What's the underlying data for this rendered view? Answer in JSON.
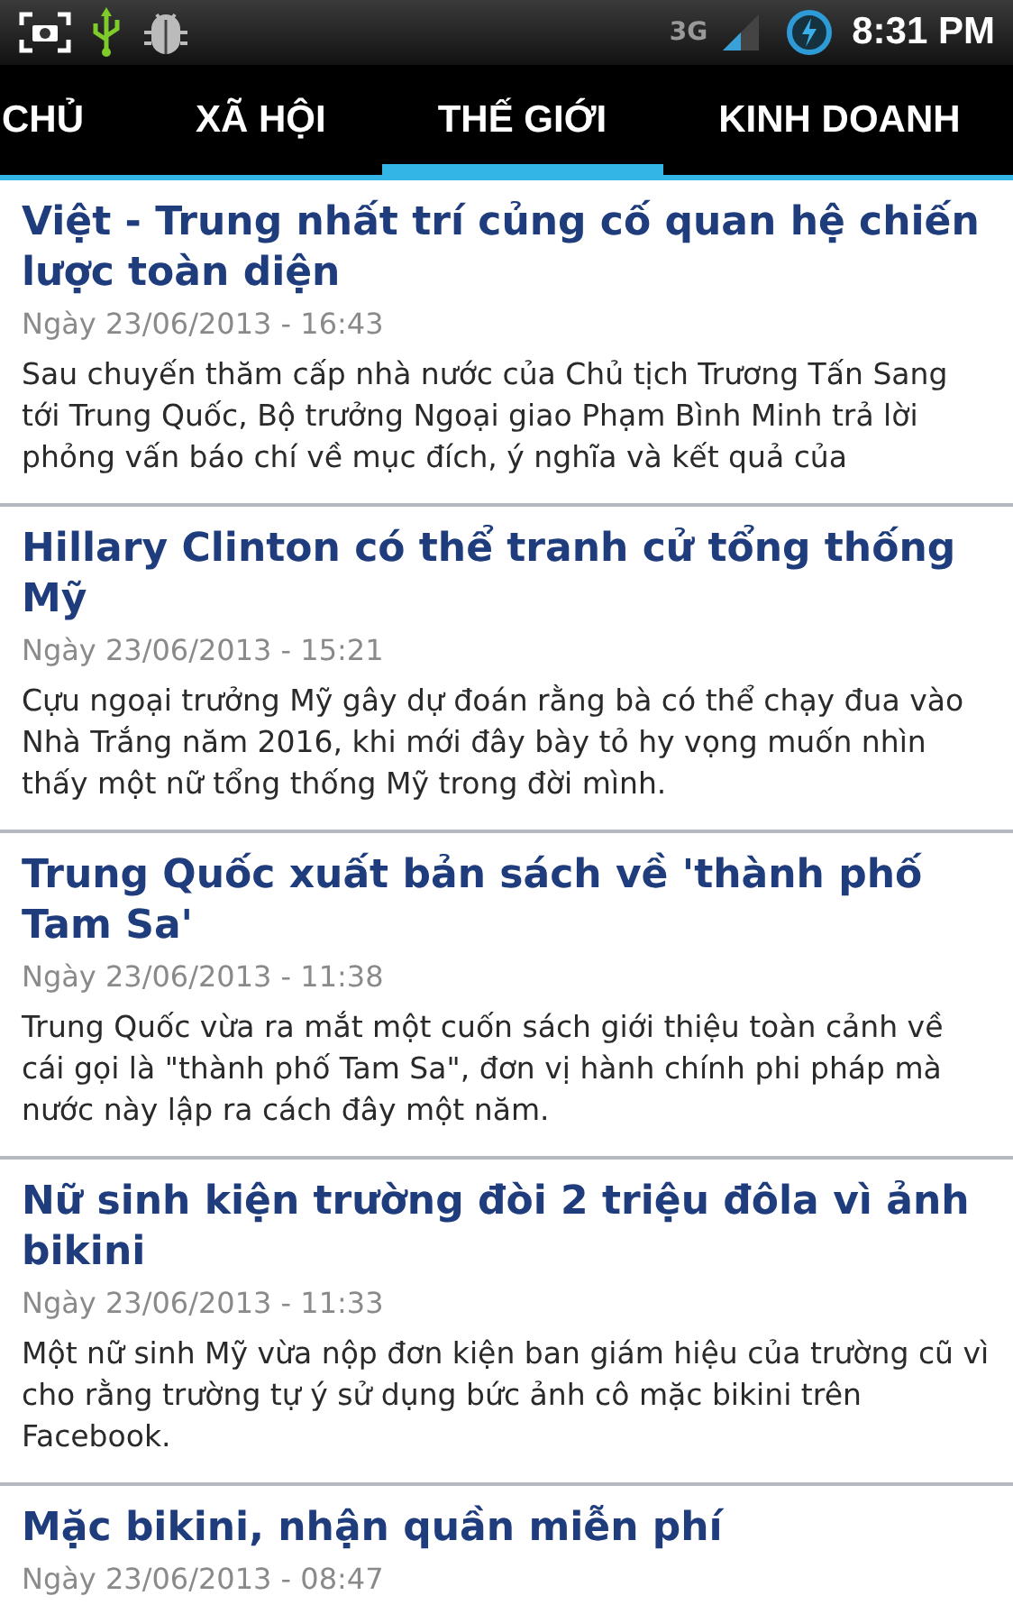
{
  "status_bar": {
    "network": "3G",
    "time": "8:31 PM"
  },
  "tabs": [
    {
      "label": "CHỦ",
      "selected": false
    },
    {
      "label": "XÃ HỘI",
      "selected": false
    },
    {
      "label": "THẾ GIỚI",
      "selected": true
    },
    {
      "label": "KINH DOANH",
      "selected": false
    }
  ],
  "articles": [
    {
      "title": "Việt - Trung nhất trí củng cố quan hệ chiến lược toàn diện",
      "date": "Ngày 23/06/2013 - 16:43",
      "summary": "Sau chuyến thăm cấp nhà nước của Chủ tịch Trương Tấn Sang tới Trung Quốc, Bộ trưởng Ngoại giao Phạm Bình Minh trả lời phỏng vấn báo chí về mục đích, ý nghĩa và kết quả của"
    },
    {
      "title": "Hillary Clinton có thể tranh cử tổng thống Mỹ",
      "date": "Ngày 23/06/2013 - 15:21",
      "summary": "Cựu ngoại trưởng Mỹ gây dự đoán rằng bà có thể chạy đua vào Nhà Trắng năm 2016, khi mới đây bày tỏ hy vọng muốn nhìn thấy một nữ tổng thống Mỹ trong đời mình."
    },
    {
      "title": "Trung Quốc xuất bản sách về 'thành phố Tam Sa'",
      "date": "Ngày 23/06/2013 - 11:38",
      "summary": "Trung Quốc vừa ra mắt một cuốn sách giới thiệu toàn cảnh về cái gọi là \"thành phố Tam Sa\", đơn vị hành chính phi pháp mà nước này lập ra cách đây một năm."
    },
    {
      "title": "Nữ sinh kiện trường đòi 2 triệu đôla vì ảnh bikini",
      "date": "Ngày 23/06/2013 - 11:33",
      "summary": "Một nữ sinh Mỹ vừa nộp đơn kiện ban giám hiệu của trường cũ vì cho rằng trường tự ý sử dụng bức ảnh cô mặc bikini trên Facebook."
    },
    {
      "title": "Mặc bikini, nhận quần miễn phí",
      "date": "Ngày 23/06/2013 - 08:47"
    }
  ]
}
